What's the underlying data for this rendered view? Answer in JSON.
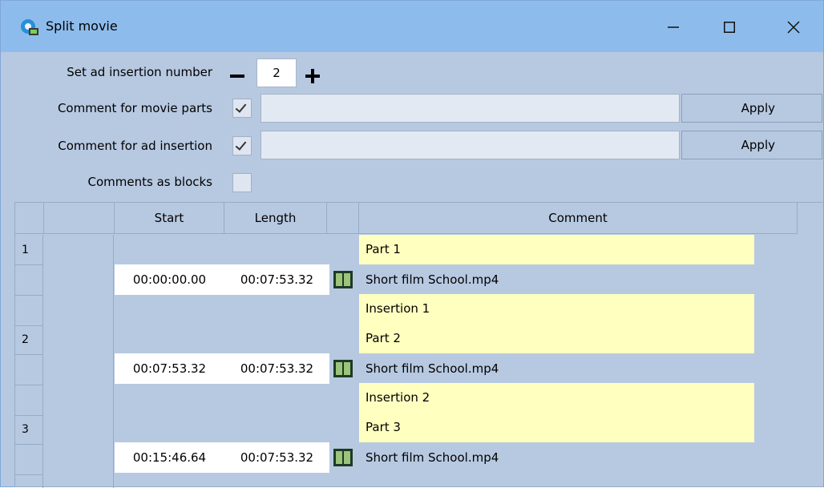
{
  "window": {
    "title": "Split movie"
  },
  "controls": {
    "ad_insertion_label": "Set ad insertion number",
    "ad_insertion_value": "2",
    "movie_parts_label": "Comment for movie parts",
    "ad_insertion_comment_label": "Comment for ad insertion",
    "blocks_label": "Comments as blocks",
    "apply_label": "Apply",
    "movie_parts_checked": true,
    "ad_comment_checked": true,
    "blocks_checked": false
  },
  "grid": {
    "columns": {
      "start": "Start",
      "length": "Length",
      "comment": "Comment"
    },
    "rows": [
      {
        "num": "1",
        "part": "Part 1",
        "start": "00:00:00.00",
        "length": "00:07:53.32",
        "file": "Short film School.mp4",
        "insertion": "Insertion 1"
      },
      {
        "num": "2",
        "part": "Part 2",
        "start": "00:07:53.32",
        "length": "00:07:53.32",
        "file": "Short film School.mp4",
        "insertion": "Insertion 2"
      },
      {
        "num": "3",
        "part": "Part 3",
        "start": "00:15:46.64",
        "length": "00:07:53.32",
        "file": "Short film School.mp4"
      }
    ]
  },
  "icons": {
    "app": "movie-app-icon",
    "film": "film-icon"
  },
  "colors": {
    "titlebar": "#8dbcec",
    "window": "#b7c9e1",
    "comment_highlight": "#ffffc0"
  }
}
